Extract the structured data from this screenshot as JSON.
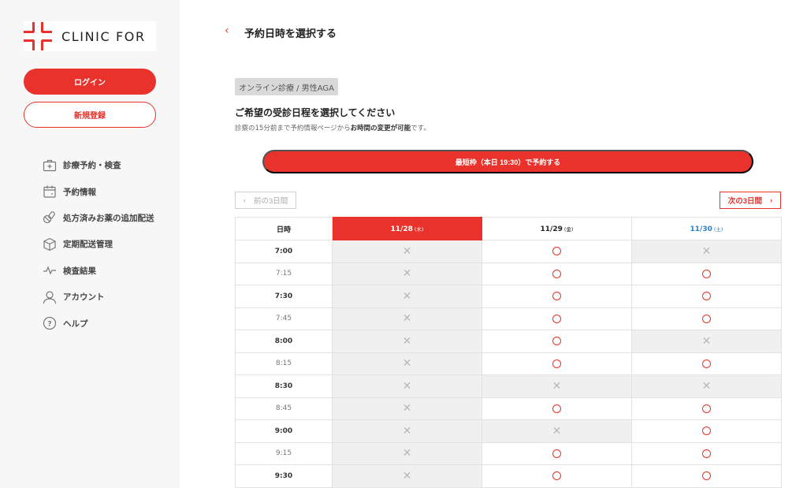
{
  "brand": {
    "name": "CLINIC FOR",
    "accent": "#e8322b"
  },
  "sidebar": {
    "login_label": "ログイン",
    "register_label": "新規登録",
    "items": [
      {
        "label": "診療予約・検査",
        "icon": "medical-kit-icon"
      },
      {
        "label": "予約情報",
        "icon": "calendar-icon"
      },
      {
        "label": "処方済みお薬の追加配送",
        "icon": "pills-icon"
      },
      {
        "label": "定期配送管理",
        "icon": "box-icon"
      },
      {
        "label": "検査結果",
        "icon": "pulse-icon"
      },
      {
        "label": "アカウント",
        "icon": "user-icon"
      },
      {
        "label": "ヘルプ",
        "icon": "help-icon"
      }
    ]
  },
  "header": {
    "back": "‹",
    "title": "予約日時を選択する"
  },
  "tag": "オンライン診療 / 男性AGA",
  "heading": "ご希望の受診日程を選択してください",
  "note": {
    "prefix": "診察の15分前まで予約情報ページから",
    "bold": "お時間の変更が可能",
    "suffix": "です。"
  },
  "fastest_button": "最短枠（本日 19:30）で予約する",
  "pager": {
    "prev": "前の3日間",
    "next": "次の3日間",
    "prev_arrow": "‹",
    "next_arrow": "›"
  },
  "table": {
    "header_time": "日時",
    "columns": [
      {
        "date": "11/28",
        "weekday": "(木)",
        "today": true,
        "saturday": false
      },
      {
        "date": "11/29",
        "weekday": "(金)",
        "today": false,
        "saturday": false
      },
      {
        "date": "11/30",
        "weekday": "(土)",
        "today": false,
        "saturday": true
      }
    ],
    "rows": [
      {
        "time": "7:00",
        "slots": [
          "×",
          "○",
          "×"
        ]
      },
      {
        "time": "7:15",
        "slots": [
          "×",
          "○",
          "○"
        ]
      },
      {
        "time": "7:30",
        "slots": [
          "×",
          "○",
          "○"
        ]
      },
      {
        "time": "7:45",
        "slots": [
          "×",
          "○",
          "○"
        ]
      },
      {
        "time": "8:00",
        "slots": [
          "×",
          "○",
          "×"
        ]
      },
      {
        "time": "8:15",
        "slots": [
          "×",
          "○",
          "○"
        ]
      },
      {
        "time": "8:30",
        "slots": [
          "×",
          "×",
          "×"
        ]
      },
      {
        "time": "8:45",
        "slots": [
          "×",
          "○",
          "○"
        ]
      },
      {
        "time": "9:00",
        "slots": [
          "×",
          "×",
          "○"
        ]
      },
      {
        "time": "9:15",
        "slots": [
          "×",
          "○",
          "○"
        ]
      },
      {
        "time": "9:30",
        "slots": [
          "×",
          "○",
          "○"
        ]
      }
    ]
  }
}
